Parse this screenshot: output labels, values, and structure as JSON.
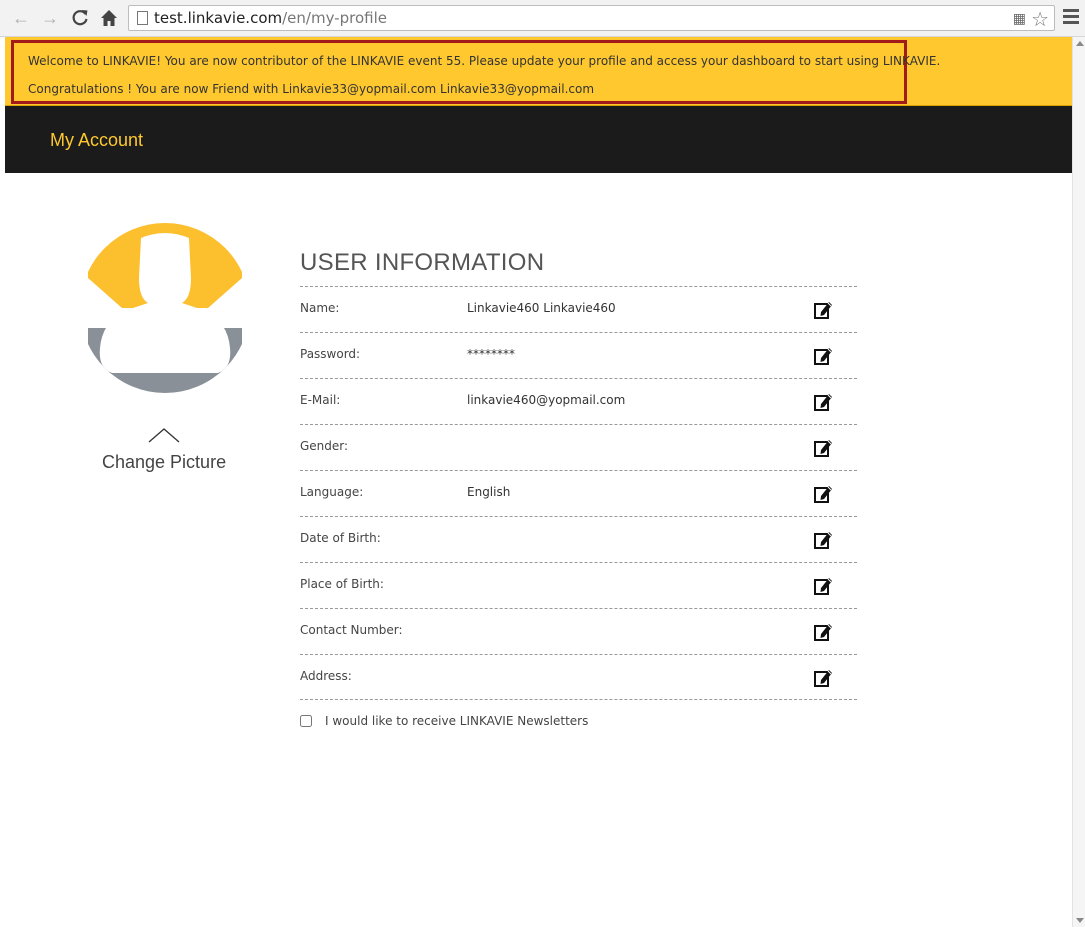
{
  "browser": {
    "url_host": "test.linkavie.com",
    "url_path": "/en/my-profile"
  },
  "notices": {
    "line1": "Welcome to LINKAVIE! You are now contributor of the LINKAVIE event 55. Please update your profile and access your dashboard to start using LINKAVIE.",
    "line2": "Congratulations ! You are now Friend with Linkavie33@yopmail.com Linkavie33@yopmail.com"
  },
  "header": {
    "title": "My Account"
  },
  "avatar": {
    "change_label": "Change Picture"
  },
  "user_info": {
    "title": "USER INFORMATION",
    "rows": [
      {
        "label": "Name:",
        "value": "Linkavie460 Linkavie460"
      },
      {
        "label": "Password:",
        "value": "********"
      },
      {
        "label": "E-Mail:",
        "value": "linkavie460@yopmail.com"
      },
      {
        "label": "Gender:",
        "value": ""
      },
      {
        "label": "Language:",
        "value": "English"
      },
      {
        "label": "Date of Birth:",
        "value": ""
      },
      {
        "label": "Place of Birth:",
        "value": ""
      },
      {
        "label": "Contact Number:",
        "value": ""
      },
      {
        "label": "Address:",
        "value": ""
      }
    ]
  },
  "newsletter": {
    "label": "I would like to receive LINKAVIE Newsletters",
    "checked": false
  },
  "colors": {
    "brand_yellow": "#ffc82e",
    "header_dark": "#1b1b1b",
    "notice_border": "#a31a1a",
    "avatar_gray": "#8a9098"
  }
}
